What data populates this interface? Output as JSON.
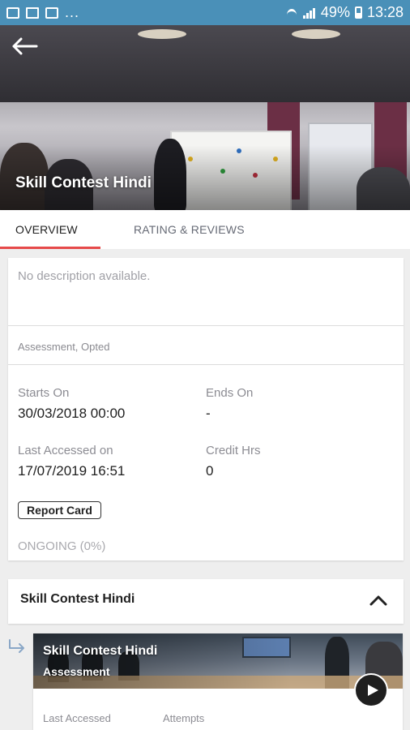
{
  "status_bar": {
    "battery": "49%",
    "time": "13:28",
    "overflow": "..."
  },
  "header": {
    "title": "Skill Contest Hindi",
    "back_icon": "arrow-left-icon"
  },
  "tabs": [
    {
      "label": "OVERVIEW",
      "active": true
    },
    {
      "label": "RATING & REVIEWS",
      "active": false
    }
  ],
  "overview": {
    "description": "No description available.",
    "tags": "Assessment, Opted",
    "starts_on_label": "Starts On",
    "starts_on_value": "30/03/2018 00:00",
    "ends_on_label": "Ends On",
    "ends_on_value": "-",
    "last_accessed_label": "Last Accessed on",
    "last_accessed_value": "17/07/2019 16:51",
    "credit_hrs_label": "Credit Hrs",
    "credit_hrs_value": "0",
    "report_card_label": "Report Card",
    "progress_text": "ONGOING (0%)"
  },
  "section": {
    "title": "Skill Contest Hindi",
    "expanded": true
  },
  "item": {
    "title": "Skill Contest Hindi",
    "subtitle": "Assessment",
    "last_accessed_label": "Last Accessed",
    "attempts_label": "Attempts"
  },
  "colors": {
    "status_bar": "#4a90b8",
    "tab_indicator": "#e64a4a"
  }
}
